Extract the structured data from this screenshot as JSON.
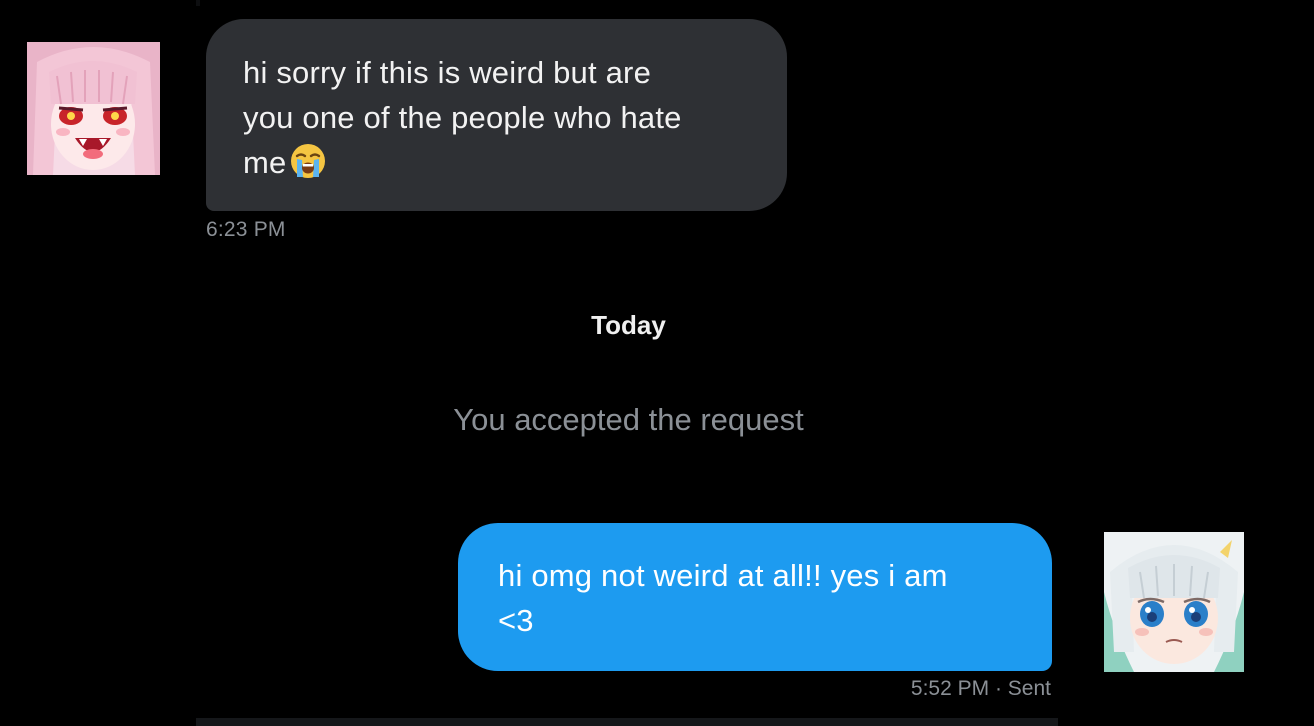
{
  "conversation": {
    "incoming": {
      "text": "hi sorry if this is weird but are\nyou one of the people who hate\nme",
      "emoji": "loudly-crying-face-emoji",
      "time": "6:23 PM"
    },
    "date_divider": "Today",
    "system_message": "You accepted the request",
    "outgoing": {
      "text": "hi omg not weird at all!! yes i am\n<3",
      "time": "5:52 PM",
      "status": "Sent",
      "separator": " · "
    }
  },
  "colors": {
    "background": "#000000",
    "incoming_bubble": "#2e3034",
    "outgoing_bubble": "#1d9bf0",
    "meta_text": "#8b9096"
  }
}
